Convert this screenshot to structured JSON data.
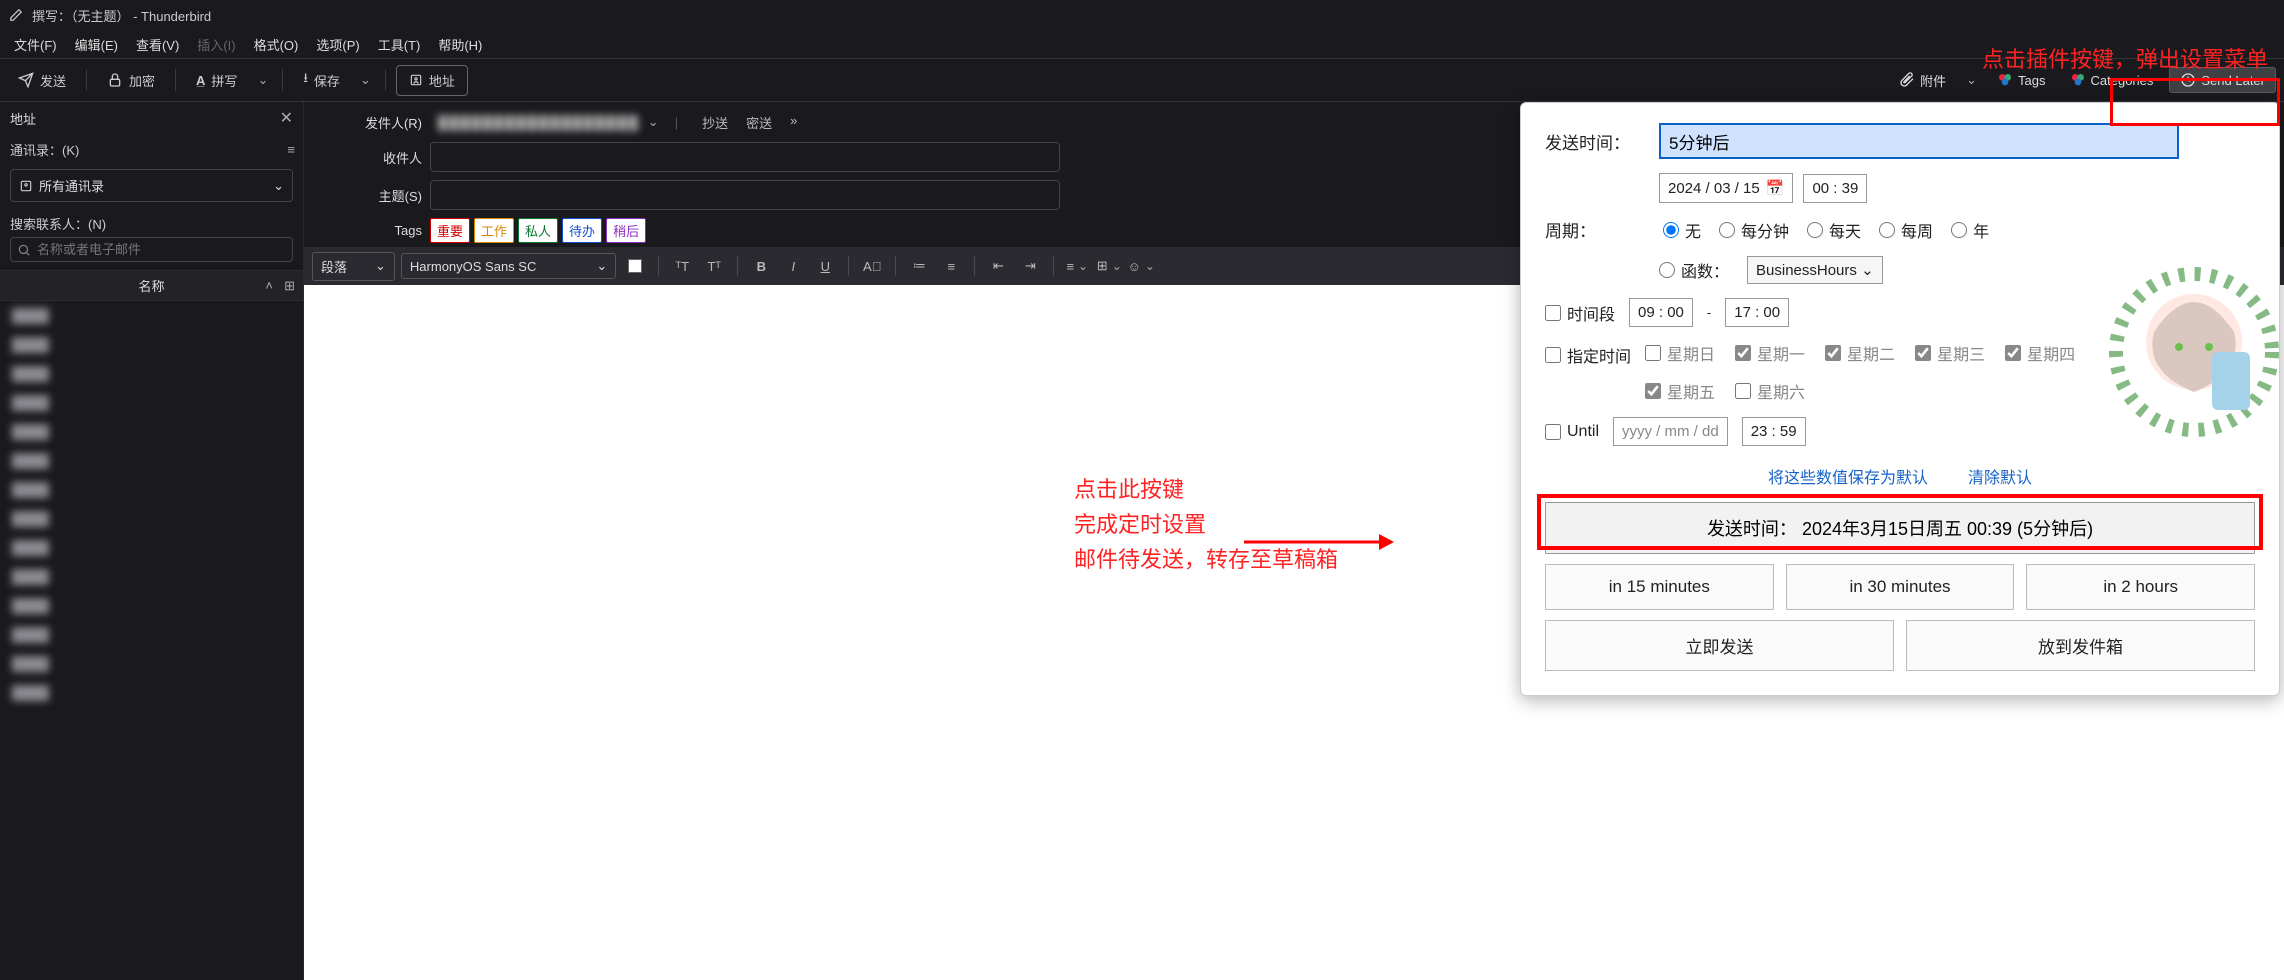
{
  "title": "撰写：（无主题） - Thunderbird",
  "menus": [
    "文件(F)",
    "编辑(E)",
    "查看(V)",
    "插入(I)",
    "格式(O)",
    "选项(P)",
    "工具(T)",
    "帮助(H)"
  ],
  "menu_disabled_index": 3,
  "toolbar": {
    "send": "发送",
    "encrypt": "加密",
    "spell": "拼写",
    "save": "保存",
    "address": "地址"
  },
  "toolbar_right": {
    "attach": "附件",
    "tags": "Tags",
    "categories": "Categories",
    "send_later": "Send Later"
  },
  "annotations": {
    "top_right": "点击插件按键，弹出设置菜单",
    "middle": "点击此按键\n完成定时设置\n邮件待发送，转存至草稿箱"
  },
  "sidebar": {
    "title": "地址",
    "book_label": "通讯录：(K)",
    "book_value": "所有通讯录",
    "search_label": "搜索联系人：(N)",
    "search_placeholder": "名称或者电子邮件",
    "name_header": "名称",
    "contacts": [
      "████",
      "████",
      "████",
      "████",
      "████",
      "████",
      "████",
      "████",
      "████",
      "████",
      "████",
      "████",
      "████",
      "████"
    ]
  },
  "fields": {
    "from_label": "发件人(R)",
    "from_blur": "██████████████████",
    "cc": "抄送",
    "bcc": "密送",
    "to_label": "收件人",
    "subject_label": "主题(S)",
    "tags_label": "Tags",
    "tags": [
      {
        "t": "重要",
        "c": "#d40000"
      },
      {
        "t": "工作",
        "c": "#d88b00"
      },
      {
        "t": "私人",
        "c": "#0a7a2f"
      },
      {
        "t": "待办",
        "c": "#1250cc"
      },
      {
        "t": "稍后",
        "c": "#8a2fbd"
      }
    ]
  },
  "format": {
    "para": "段落",
    "font": "HarmonyOS Sans SC"
  },
  "popup": {
    "send_time_label": "发送时间：",
    "send_time_value": "5分钟后",
    "date": "2024 / 03 / 15",
    "time": "00 : 39",
    "recur_label": "周期：",
    "recur": {
      "none": "无",
      "min": "每分钟",
      "day": "每天",
      "week": "每周",
      "year": "年"
    },
    "func_label": "函数：",
    "func_value": "BusinessHours",
    "slot_label": "时间段",
    "slot_from": "09 : 00",
    "slot_to": "17 : 00",
    "spec_label": "指定时间",
    "days": [
      "星期日",
      "星期一",
      "星期二",
      "星期三",
      "星期四",
      "星期五",
      "星期六"
    ],
    "days_checked": [
      false,
      true,
      true,
      true,
      true,
      true,
      false
    ],
    "until_label": "Until",
    "until_date_ph": "yyyy / mm / dd",
    "until_time": "23 : 59",
    "save_defaults": "将这些数值保存为默认",
    "clear_defaults": "清除默认",
    "big_button": "发送时间：  2024年3月15日周五 00:39 (5分钟后)",
    "quick": [
      "in 15 minutes",
      "in 30 minutes",
      "in 2 hours"
    ],
    "now": "立即发送",
    "outbox": "放到发件箱"
  }
}
